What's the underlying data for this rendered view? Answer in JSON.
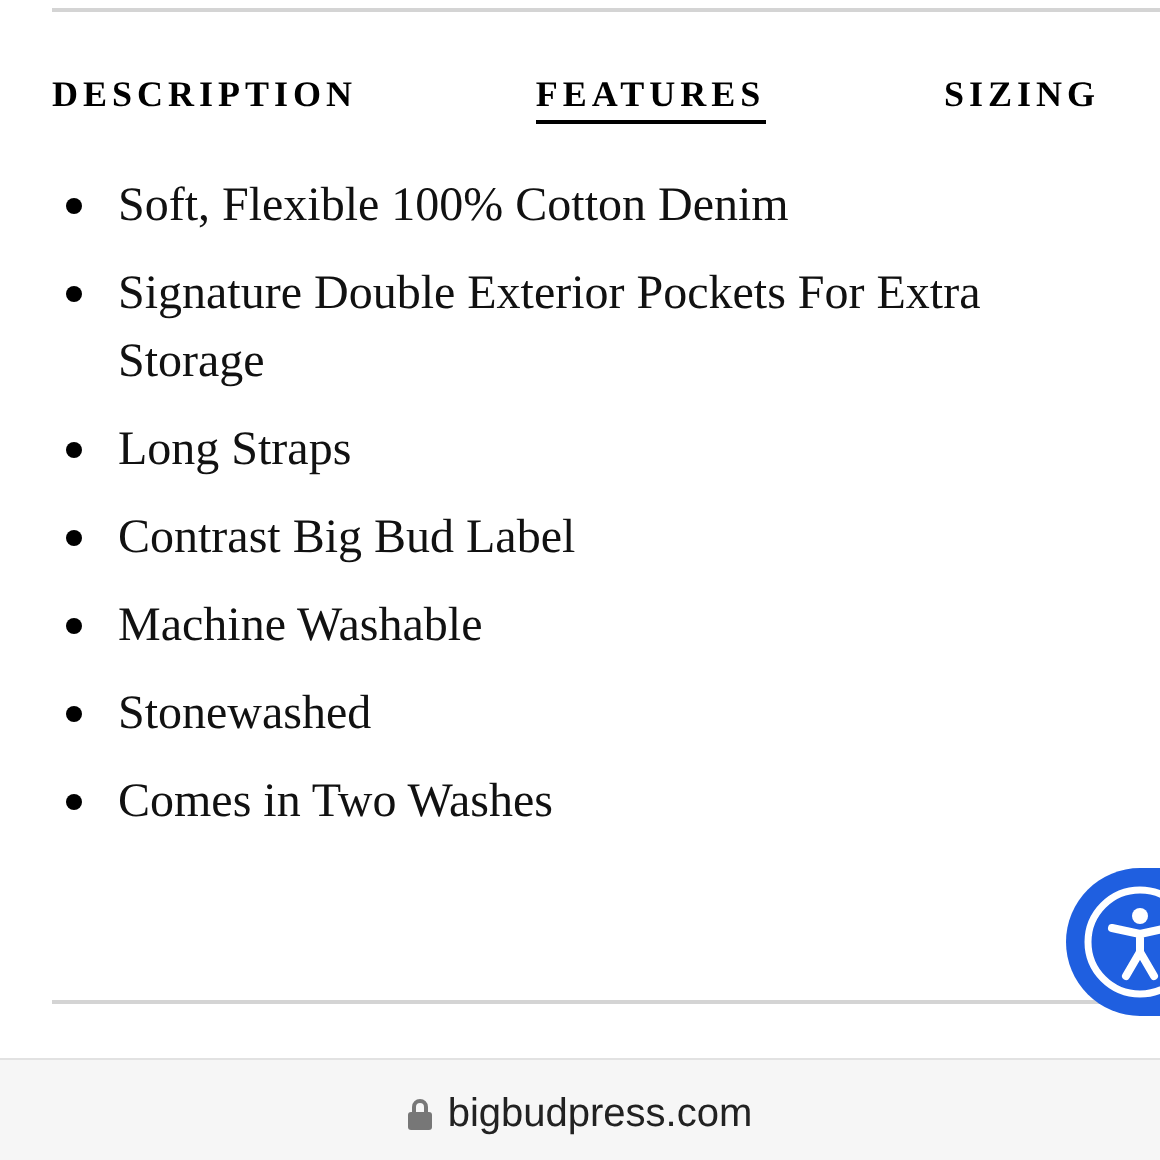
{
  "tabs": [
    {
      "label": "DESCRIPTION",
      "selected": false
    },
    {
      "label": "FEATURES",
      "selected": true
    },
    {
      "label": "SIZING",
      "selected": false
    }
  ],
  "features": [
    "Soft, Flexible 100% Cotton Denim",
    "Signature Double Exterior Pockets For Extra Storage",
    "Long Straps",
    "Contrast Big Bud Label",
    "Machine Washable",
    "Stonewashed",
    "Comes in Two Washes"
  ],
  "address_bar": {
    "url": "bigbudpress.com",
    "secure": true
  }
}
